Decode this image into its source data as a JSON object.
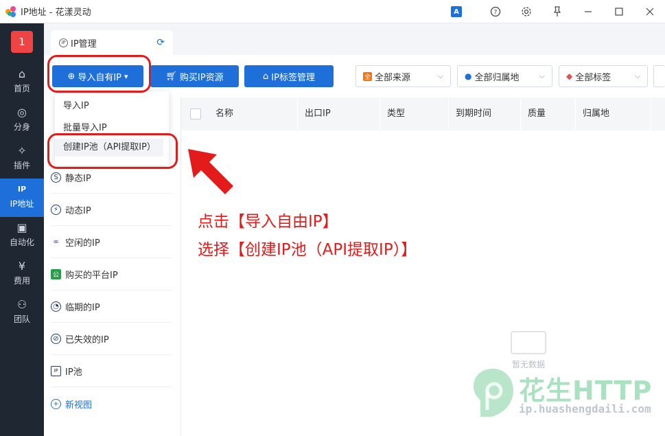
{
  "window": {
    "title": "IP地址 - 花漾灵动",
    "translate_label": "A"
  },
  "nav": {
    "account_badge": "1",
    "items": [
      {
        "label": "首页",
        "icon": "⌂"
      },
      {
        "label": "分身",
        "icon": "◎"
      },
      {
        "label": "插件",
        "icon": "✧"
      },
      {
        "label": "IP地址",
        "icon": "IP"
      },
      {
        "label": "自动化",
        "icon": "▣"
      },
      {
        "label": "费用",
        "icon": "¥"
      },
      {
        "label": "团队",
        "icon": "⚇"
      }
    ],
    "active_index": 3
  },
  "tab": {
    "label": "IP管理",
    "icon_text": "IP"
  },
  "toolbar": {
    "import_label": "导入自有IP",
    "buy_label": "购买IP资源",
    "tag_label": "IP标签管理",
    "filters": [
      "全部来源",
      "全部归属地",
      "全部标签"
    ]
  },
  "dropdown": {
    "items": [
      "导入IP",
      "批量导入IP",
      "创建IP池（API提取IP）"
    ]
  },
  "side": {
    "items": [
      {
        "label": "静态IP",
        "icon": "S"
      },
      {
        "label": "动态IP",
        "icon": "⚡"
      },
      {
        "label": "空闲的IP",
        "icon": "∞"
      },
      {
        "label": "购买的平台IP",
        "icon": "公"
      },
      {
        "label": "临期的IP",
        "icon": "◔"
      },
      {
        "label": "已失效的IP",
        "icon": "⊘"
      },
      {
        "label": "IP池",
        "icon": "IP"
      }
    ],
    "new_view": "新视图"
  },
  "table": {
    "columns": [
      "名称",
      "出口IP",
      "类型",
      "到期时间",
      "质量",
      "归属地"
    ],
    "empty_text": "暂无数据"
  },
  "annotation": {
    "line1": "点击【导入自由IP】",
    "line2": "选择【创建IP池（API提取IP）】"
  },
  "watermark": {
    "brand": "花生HTTP",
    "url": "ip.huashengdaili.com"
  },
  "colors": {
    "accent": "#1e6fd9",
    "nav_bg": "#1f2733",
    "annotation_red": "#e31b1b"
  }
}
